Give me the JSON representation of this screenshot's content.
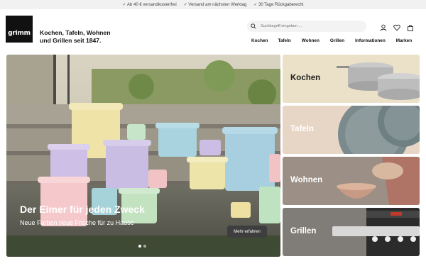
{
  "topbar": {
    "items": [
      "✓ Ab 40 € versandkostenfrei",
      "✓ Versand am nächsten Werktag",
      "✓ 30 Tage Rückgaberecht"
    ]
  },
  "header": {
    "logo_text": "grimm",
    "tagline_line1": "Kochen, Tafeln, Wohnen",
    "tagline_line2": "und Grillen seit 1847."
  },
  "search": {
    "placeholder": "Suchbegriff eingeben ..."
  },
  "nav": {
    "items": [
      "Kochen",
      "Tafeln",
      "Wohnen",
      "Grillen",
      "Informationen",
      "Marken"
    ]
  },
  "hero": {
    "title": "Der Eimer für jeden Zweck",
    "subtitle": "Neue Farben neue Frische für zu Hause",
    "button_label": "Mehr erfahren",
    "slide_count": 2,
    "active_slide": 1
  },
  "tiles": [
    {
      "label": "Kochen",
      "color": "#ebe0c8"
    },
    {
      "label": "Tafeln",
      "color": "#e7d6c6"
    },
    {
      "label": "Wohnen",
      "color": "#9b8f86"
    },
    {
      "label": "Grillen",
      "color": "#807d78"
    }
  ]
}
